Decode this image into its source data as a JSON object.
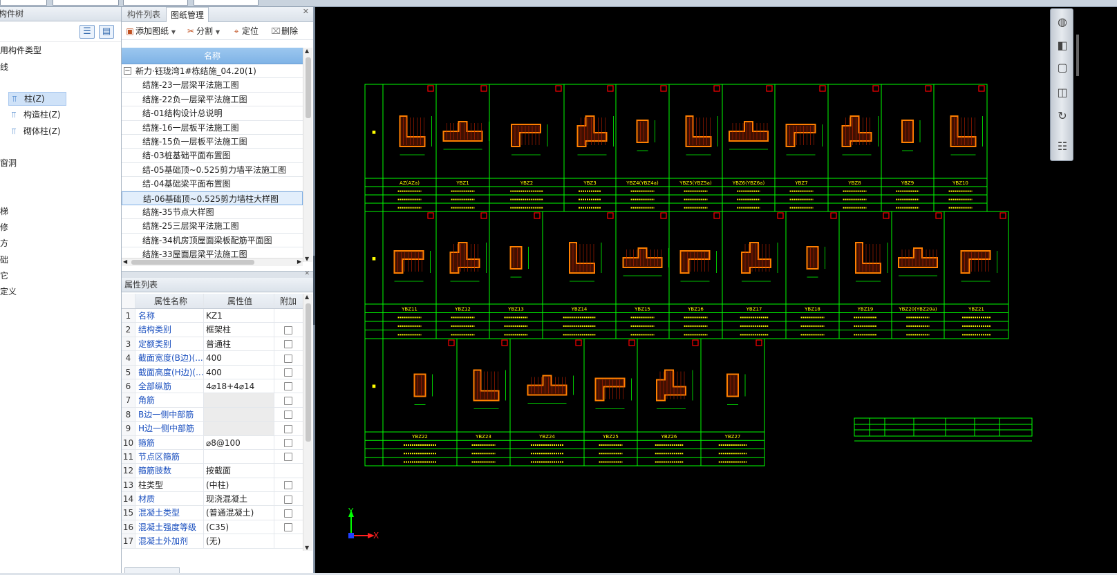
{
  "left_panel": {
    "title": "构件树",
    "tree": [
      {
        "label": "常用构件类型",
        "level": 0
      },
      {
        "label": "轴线",
        "level": 0
      },
      {
        "label": "柱",
        "level": 0
      },
      {
        "label": "柱(Z)",
        "level": 1,
        "selected": true
      },
      {
        "label": "构造柱(Z)",
        "level": 1
      },
      {
        "label": "砌体柱(Z)",
        "level": 1
      },
      {
        "label": "墙",
        "level": 0
      },
      {
        "label": "门窗洞",
        "level": 0
      },
      {
        "label": "梁",
        "level": 0
      },
      {
        "label": "板",
        "level": 0
      },
      {
        "label": "楼梯",
        "level": 0
      },
      {
        "label": "装修",
        "level": 0
      },
      {
        "label": "土方",
        "level": 0
      },
      {
        "label": "基础",
        "level": 0
      },
      {
        "label": "其它",
        "level": 0
      },
      {
        "label": "自定义",
        "level": 0
      }
    ]
  },
  "drawing_panel": {
    "tabs": [
      "构件列表",
      "图纸管理"
    ],
    "active_tab": "图纸管理",
    "toolbar": {
      "add": "添加图纸",
      "split": "分割",
      "locate": "定位",
      "delete": "删除"
    },
    "list_header": "名称",
    "root": "新力·钰珑湾1#栋结施_04.20(1)",
    "items": [
      "结施-23一层梁平法施工图",
      "结施-22负一层梁平法施工图",
      "结-01结构设计总说明",
      "结施-16一层板平法施工图",
      "结施-15负一层板平法施工图",
      "结-03桩基础平面布置图",
      "结-05基础顶~0.525剪力墙平法施工图",
      "结-04基础梁平面布置图",
      "结-06基础顶~0.525剪力墙柱大样图",
      "结施-35节点大样图",
      "结施-25三层梁平法施工图",
      "结施-34机房顶屋面梁板配筋平面图",
      "结施-33屋面层梁平法施工图"
    ],
    "selected_index": 8
  },
  "props_panel": {
    "title": "属性列表",
    "headers": [
      "属性名称",
      "属性值",
      "附加"
    ],
    "rows": [
      {
        "n": "1",
        "name": "名称",
        "value": "KZ1",
        "blue": true,
        "check": false
      },
      {
        "n": "2",
        "name": "结构类别",
        "value": "框架柱",
        "blue": true,
        "check": true
      },
      {
        "n": "3",
        "name": "定额类别",
        "value": "普通柱",
        "blue": true,
        "check": true
      },
      {
        "n": "4",
        "name": "截面宽度(B边)(...",
        "value": "400",
        "blue": true,
        "check": true
      },
      {
        "n": "5",
        "name": "截面高度(H边)(...",
        "value": "400",
        "blue": true,
        "check": true
      },
      {
        "n": "6",
        "name": "全部纵筋",
        "value": "4⌀18+4⌀14",
        "blue": true,
        "check": true
      },
      {
        "n": "7",
        "name": "角筋",
        "value": "",
        "blue": true,
        "check": true
      },
      {
        "n": "8",
        "name": "B边一侧中部筋",
        "value": "",
        "blue": true,
        "check": true
      },
      {
        "n": "9",
        "name": "H边一侧中部筋",
        "value": "",
        "blue": true,
        "check": true
      },
      {
        "n": "10",
        "name": "箍筋",
        "value": "⌀8@100",
        "blue": true,
        "check": true
      },
      {
        "n": "11",
        "name": "节点区箍筋",
        "value": "",
        "blue": true,
        "check": true
      },
      {
        "n": "12",
        "name": "箍筋肢数",
        "value": "按截面",
        "blue": true,
        "check": false
      },
      {
        "n": "13",
        "name": "柱类型",
        "value": "(中柱)",
        "blue": false,
        "check": true
      },
      {
        "n": "14",
        "name": "材质",
        "value": "现浇混凝土",
        "blue": true,
        "check": true
      },
      {
        "n": "15",
        "name": "混凝土类型",
        "value": "(普通混凝土)",
        "blue": true,
        "check": true
      },
      {
        "n": "16",
        "name": "混凝土强度等级",
        "value": "(C35)",
        "blue": true,
        "check": true
      },
      {
        "n": "17",
        "name": "混凝土外加剂",
        "value": "(无)",
        "blue": true,
        "check": false
      }
    ]
  },
  "canvas": {
    "row1_labels": [
      "AZ(AZa)",
      "YBZ1",
      "YBZ2",
      "YBZ3",
      "YBZ4(YBZ4a)",
      "YBZ5(YBZ5a)",
      "YBZ6(YBZ6a)",
      "YBZ7",
      "YBZ8",
      "YBZ9",
      "YBZ10"
    ],
    "row2_labels": [
      "YBZ11",
      "YBZ12",
      "YBZ13",
      "YBZ14",
      "YBZ15",
      "YBZ16",
      "YBZ17",
      "YBZ18",
      "YBZ19",
      "YBZ20(YBZ20a)",
      "YBZ21"
    ],
    "row3_labels": [
      "YBZ22",
      "YBZ23",
      "YBZ24",
      "YBZ25",
      "YBZ26",
      "YBZ27"
    ],
    "axis_x": "X",
    "axis_y": "Y",
    "colors": {
      "lines": "#00ff00",
      "columns": "#ff8000",
      "marks": "#ff0000",
      "text": "#ffff00"
    }
  },
  "nav_icons": [
    "orbit-icon",
    "view-3d-icon",
    "top-view-icon",
    "cube-icon",
    "rotate-icon",
    "layers-icon"
  ]
}
